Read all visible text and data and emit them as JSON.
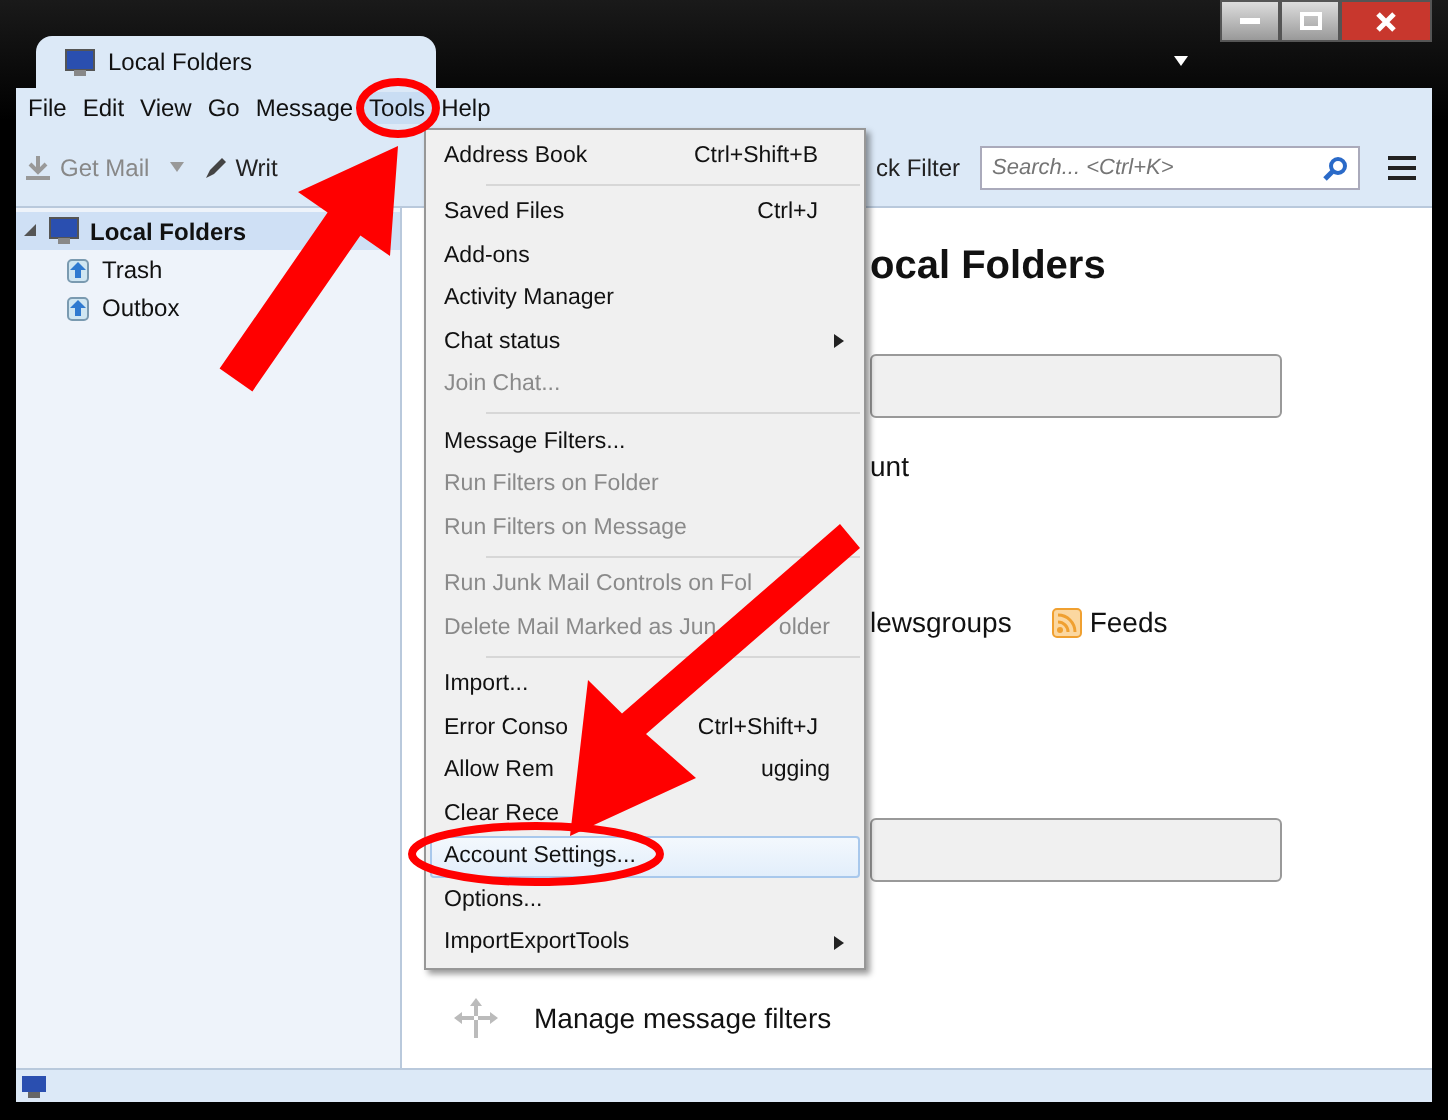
{
  "window": {
    "tab_title": "Local Folders"
  },
  "menubar": [
    {
      "label": "File",
      "selected": false
    },
    {
      "label": "Edit",
      "selected": false
    },
    {
      "label": "View",
      "selected": false
    },
    {
      "label": "Go",
      "selected": false
    },
    {
      "label": "Message",
      "selected": false
    },
    {
      "label": "Tools",
      "selected": true
    },
    {
      "label": "Help",
      "selected": false
    }
  ],
  "toolbar": {
    "get_mail": "Get Mail",
    "write": "Writ",
    "quick_filter": "ck Filter",
    "search": {
      "placeholder": "Search... <Ctrl+K>"
    }
  },
  "folders": [
    {
      "label": "Local Folders",
      "selected": true,
      "expanded": true,
      "children": [
        {
          "label": "Trash",
          "selected": false
        },
        {
          "label": "Outbox",
          "selected": false
        }
      ]
    }
  ],
  "content": {
    "heading": "ocal Folders",
    "account_text": "unt",
    "newsgroups": "lewsgroups",
    "feeds": "Feeds",
    "manage_filters": "Manage message filters"
  },
  "tools_menu": [
    {
      "kind": "item",
      "label": "Address Book",
      "shortcut": "Ctrl+Shift+B",
      "disabled": false,
      "selected": false
    },
    {
      "kind": "separator"
    },
    {
      "kind": "item",
      "label": "Saved Files",
      "shortcut": "Ctrl+J",
      "disabled": false,
      "selected": false
    },
    {
      "kind": "item",
      "label": "Add-ons",
      "disabled": false,
      "selected": false
    },
    {
      "kind": "item",
      "label": "Activity Manager",
      "disabled": false,
      "selected": false
    },
    {
      "kind": "item",
      "label": "Chat status",
      "submenu": true,
      "disabled": false,
      "selected": false
    },
    {
      "kind": "item",
      "label": "Join Chat...",
      "disabled": true,
      "selected": false
    },
    {
      "kind": "separator"
    },
    {
      "kind": "item",
      "label": "Message Filters...",
      "disabled": false,
      "selected": false
    },
    {
      "kind": "item",
      "label": "Run Filters on Folder",
      "disabled": true,
      "selected": false
    },
    {
      "kind": "item",
      "label": "Run Filters on Message",
      "disabled": true,
      "selected": false
    },
    {
      "kind": "separator"
    },
    {
      "kind": "item",
      "label": "Run Junk Mail Controls on Fol",
      "disabled": true,
      "selected": false
    },
    {
      "kind": "item",
      "label": "Delete Mail Marked as Jun",
      "tail": "older",
      "disabled": true,
      "selected": false
    },
    {
      "kind": "separator"
    },
    {
      "kind": "item",
      "label": "Import...",
      "disabled": false,
      "selected": false
    },
    {
      "kind": "item",
      "label": "Error Conso",
      "shortcut": "Ctrl+Shift+J",
      "disabled": false,
      "selected": false
    },
    {
      "kind": "item",
      "label": "Allow Rem",
      "tail": "ugging",
      "disabled": false,
      "selected": false
    },
    {
      "kind": "item",
      "label": "Clear Rece",
      "disabled": false,
      "selected": false
    },
    {
      "kind": "item",
      "label": "Account Settings...",
      "disabled": false,
      "selected": true
    },
    {
      "kind": "item",
      "label": "Options...",
      "disabled": false,
      "selected": false
    },
    {
      "kind": "item",
      "label": "ImportExportTools",
      "submenu": true,
      "disabled": false,
      "selected": false
    }
  ]
}
